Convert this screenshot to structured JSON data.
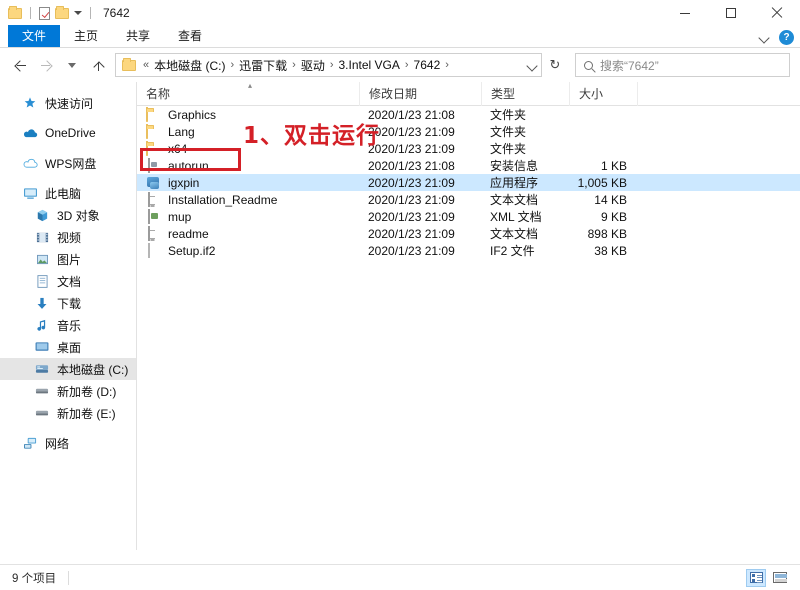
{
  "window": {
    "title": "7642",
    "quick_access": [
      "folder-icon",
      "properties-icon",
      "new-folder-icon",
      "customize-dropdown-icon"
    ],
    "controls": {
      "minimize": "—",
      "maximize": "☐",
      "close": "✕"
    }
  },
  "ribbon": {
    "tabs": [
      {
        "label": "文件",
        "active": true
      },
      {
        "label": "主页",
        "active": false
      },
      {
        "label": "共享",
        "active": false
      },
      {
        "label": "查看",
        "active": false
      }
    ],
    "expand_icon": "chevron-down-icon",
    "help_label": "?"
  },
  "address": {
    "back_icon": "arrow-left-icon",
    "forward_icon": "arrow-right-icon",
    "recent_icon": "chevron-down-icon",
    "up_icon": "arrow-up-icon",
    "prefix": "«",
    "crumbs": [
      "本地磁盘 (C:)",
      "迅雷下载",
      "驱动",
      "3.Intel VGA",
      "7642"
    ],
    "separator": "›",
    "refresh_icon": "↻"
  },
  "search": {
    "icon": "search-icon",
    "placeholder": "搜索“7642”"
  },
  "sidebar": {
    "items": [
      {
        "label": "快速访问",
        "icon": "star-icon",
        "level": 0,
        "selected": false,
        "gap_after": true
      },
      {
        "label": "OneDrive",
        "icon": "cloud-icon",
        "level": 0,
        "selected": false,
        "gap_after": true
      },
      {
        "label": "WPS网盘",
        "icon": "cloud-outline-icon",
        "level": 0,
        "selected": false,
        "gap_after": true
      },
      {
        "label": "此电脑",
        "icon": "computer-icon",
        "level": 0,
        "selected": false,
        "gap_after": false
      },
      {
        "label": "3D 对象",
        "icon": "cube-icon",
        "level": 1,
        "selected": false,
        "gap_after": false
      },
      {
        "label": "视频",
        "icon": "video-icon",
        "level": 1,
        "selected": false,
        "gap_after": false
      },
      {
        "label": "图片",
        "icon": "picture-icon",
        "level": 1,
        "selected": false,
        "gap_after": false
      },
      {
        "label": "文档",
        "icon": "document-icon",
        "level": 1,
        "selected": false,
        "gap_after": false
      },
      {
        "label": "下载",
        "icon": "download-icon",
        "level": 1,
        "selected": false,
        "gap_after": false
      },
      {
        "label": "音乐",
        "icon": "music-icon",
        "level": 1,
        "selected": false,
        "gap_after": false
      },
      {
        "label": "桌面",
        "icon": "desktop-icon",
        "level": 1,
        "selected": false,
        "gap_after": false
      },
      {
        "label": "本地磁盘 (C:)",
        "icon": "harddisk-icon",
        "level": 1,
        "selected": true,
        "gap_after": false
      },
      {
        "label": "新加卷 (D:)",
        "icon": "drive-icon",
        "level": 1,
        "selected": false,
        "gap_after": false
      },
      {
        "label": "新加卷 (E:)",
        "icon": "drive-icon",
        "level": 1,
        "selected": false,
        "gap_after": true
      },
      {
        "label": "网络",
        "icon": "network-icon",
        "level": 0,
        "selected": false,
        "gap_after": false
      }
    ]
  },
  "file_list": {
    "columns": [
      {
        "label": "名称",
        "sorted": "asc"
      },
      {
        "label": "修改日期",
        "sorted": ""
      },
      {
        "label": "类型",
        "sorted": ""
      },
      {
        "label": "大小",
        "sorted": ""
      }
    ],
    "rows": [
      {
        "name": "Graphics",
        "date": "2020/1/23 21:08",
        "type": "文件夹",
        "size": "",
        "icon": "folder-icon",
        "selected": false
      },
      {
        "name": "Lang",
        "date": "2020/1/23 21:09",
        "type": "文件夹",
        "size": "",
        "icon": "folder-icon",
        "selected": false
      },
      {
        "name": "x64",
        "date": "2020/1/23 21:09",
        "type": "文件夹",
        "size": "",
        "icon": "folder-icon",
        "selected": false
      },
      {
        "name": "autorun",
        "date": "2020/1/23 21:08",
        "type": "安装信息",
        "size": "1 KB",
        "icon": "setup-information-icon",
        "selected": false
      },
      {
        "name": "igxpin",
        "date": "2020/1/23 21:09",
        "type": "应用程序",
        "size": "1,005 KB",
        "icon": "application-icon",
        "selected": true
      },
      {
        "name": "Installation_Readme",
        "date": "2020/1/23 21:09",
        "type": "文本文档",
        "size": "14 KB",
        "icon": "text-document-icon",
        "selected": false
      },
      {
        "name": "mup",
        "date": "2020/1/23 21:09",
        "type": "XML 文档",
        "size": "9 KB",
        "icon": "xml-document-icon",
        "selected": false
      },
      {
        "name": "readme",
        "date": "2020/1/23 21:09",
        "type": "文本文档",
        "size": "898 KB",
        "icon": "text-document-icon",
        "selected": false
      },
      {
        "name": "Setup.if2",
        "date": "2020/1/23 21:09",
        "type": "IF2 文件",
        "size": "38 KB",
        "icon": "blank-file-icon",
        "selected": false
      }
    ]
  },
  "annotation": {
    "text": "1、双击运行",
    "color": "#d42027"
  },
  "statusbar": {
    "item_count": "9 个项目",
    "view_details": "details-view-icon",
    "view_tiles": "large-icons-view-icon"
  }
}
